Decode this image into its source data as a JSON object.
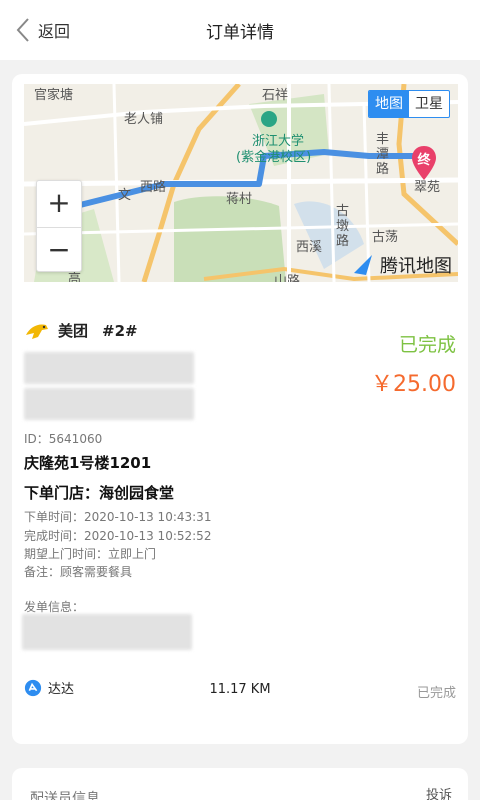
{
  "header": {
    "back_label": "返回",
    "title": "订单详情"
  },
  "map": {
    "toggle": [
      "地图",
      "卫星"
    ],
    "active_option": "地图",
    "zoom_in": "+",
    "zoom_out": "−",
    "provider": "腾讯地图",
    "end_marker": "终",
    "places": {
      "p1": "官家塘",
      "p2": "老人铺",
      "p3": "浙江大学",
      "p4": "(紫金港校区)",
      "p5": "蒋村",
      "p6": "西溪",
      "p7": "古荡",
      "p8": "古墩路",
      "p9": "丰潭路",
      "p10": "翠苑",
      "p11": "西路",
      "p12": "石祥",
      "p13": "文",
      "p14": "高",
      "p15": "山路"
    }
  },
  "order": {
    "platform": "美团",
    "number": "#2#",
    "status": "已完成",
    "price": "￥25.00",
    "id_text": "ID：5641060",
    "address": "庆隆苑1号楼1201",
    "store": "下单门店：海创园食堂",
    "order_time": "下单时间：2020-10-13 10:43:31",
    "complete_time": "完成时间：2020-10-13 10:52:52",
    "expected_time": "期望上门时间：立即上门",
    "note": "备注：顾客需要餐具",
    "sender_label": "发单信息："
  },
  "delivery": {
    "courier": "达达",
    "distance": "11.17 KM",
    "status": "已完成"
  },
  "courier_section": {
    "title": "配送员信息",
    "complaint": "投诉"
  },
  "colors": {
    "status_green": "#7dc242",
    "price_orange": "#f56a2e",
    "map_route": "#4a90e2",
    "map_toggle_active": "#2e8df0",
    "end_marker": "#e9406a"
  },
  "icons": {
    "back": "chevron-left-icon",
    "platform": "meituan-kangaroo-icon",
    "courier": "dada-logo-icon",
    "map_provider": "tencent-map-logo-icon",
    "end_marker": "map-pin-icon"
  }
}
